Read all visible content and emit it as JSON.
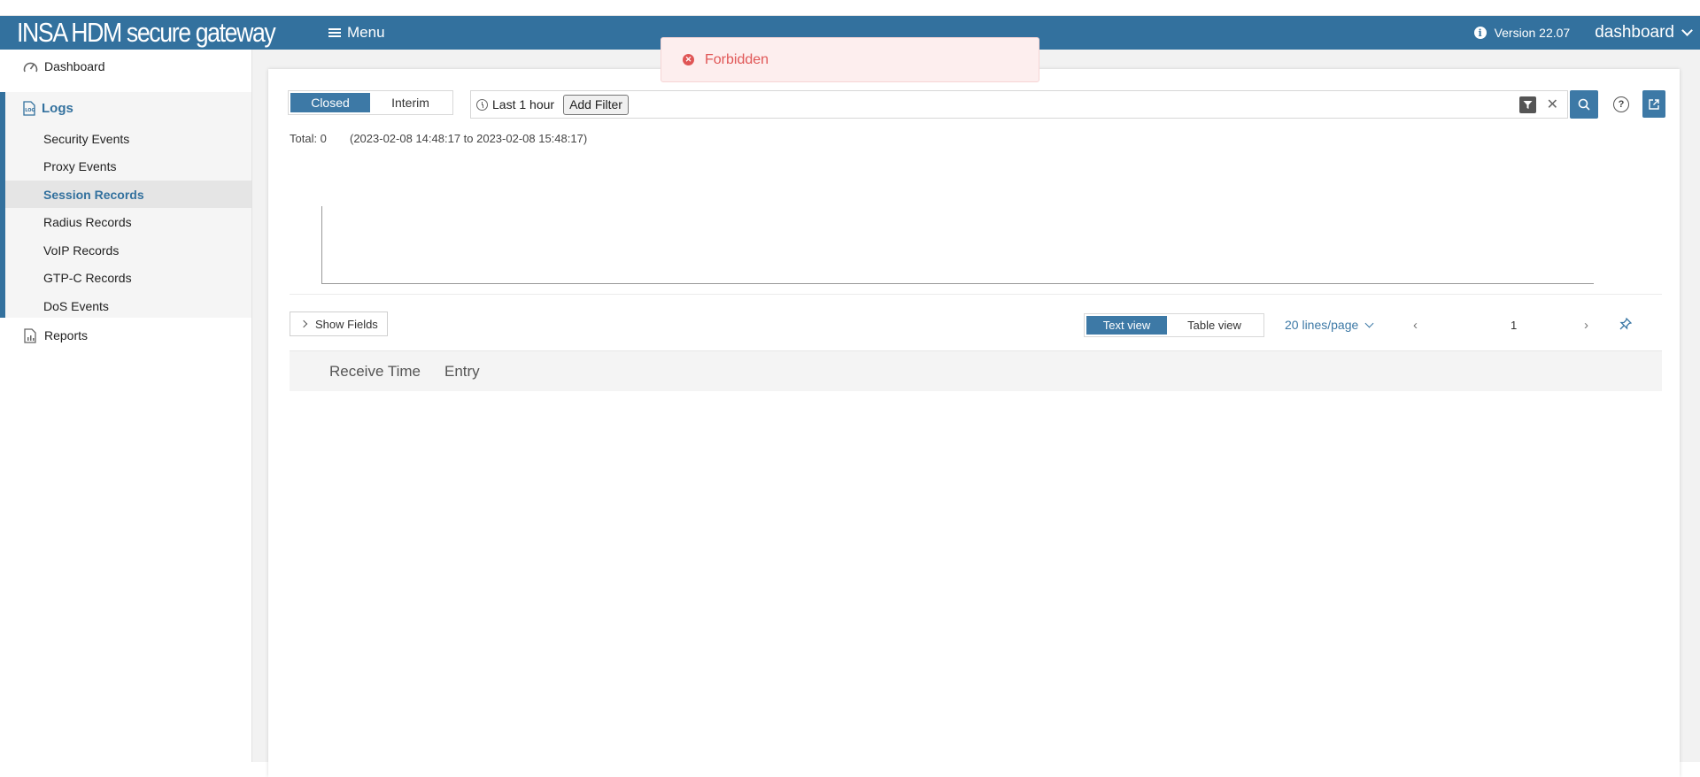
{
  "header": {
    "brand": "INSA HDM secure gateway",
    "menu_label": "Menu",
    "version": "Version 22.07",
    "user": "dashboard"
  },
  "sidebar": {
    "dashboard": "Dashboard",
    "logs": "Logs",
    "sub_items": [
      "Security Events",
      "Proxy Events",
      "Session Records",
      "Radius Records",
      "VoIP Records",
      "GTP-C Records",
      "DoS Events"
    ],
    "active_sub": "Session Records",
    "reports": "Reports"
  },
  "toast": {
    "message": "Forbidden"
  },
  "filters": {
    "state_tabs": [
      "Closed",
      "Interim"
    ],
    "active_state": "Closed",
    "time_range": "Last 1 hour",
    "add_filter": "Add Filter"
  },
  "summary": {
    "total": "Total: 0",
    "range": "(2023-02-08 14:48:17 to 2023-02-08 15:48:17)"
  },
  "view": {
    "show_fields": "Show Fields",
    "views": [
      "Text view",
      "Table view"
    ],
    "active_view": "Text view",
    "lines_per_page": "20 lines/page",
    "page": "1"
  },
  "table": {
    "columns": [
      "Receive Time",
      "Entry"
    ]
  },
  "colors": {
    "header_bg": "#33719e",
    "accent": "#3d79a6",
    "error": "#e05555"
  }
}
